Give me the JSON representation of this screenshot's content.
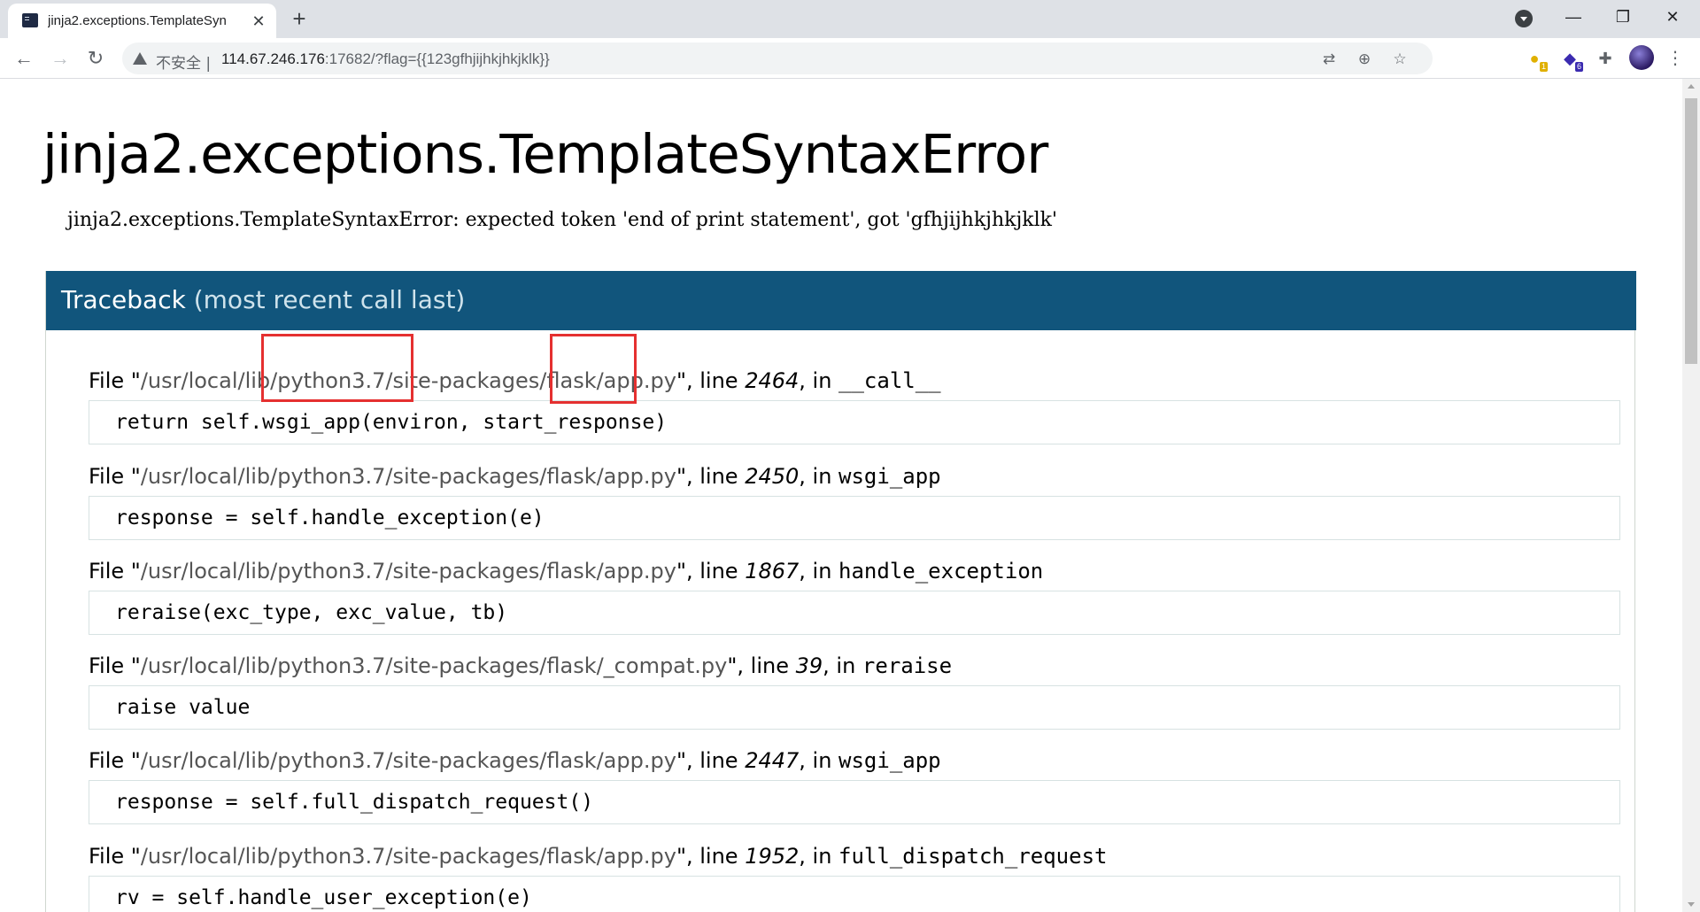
{
  "browser": {
    "tab_title": "jinja2.exceptions.TemplateSyn",
    "tab_close": "✕",
    "new_tab": "+",
    "minimize": "—",
    "maximize": "❐",
    "close": "✕",
    "back": "←",
    "forward": "→",
    "reload": "↻",
    "insecure_label": "不安全 |",
    "url_host": "114.67.246.176",
    "url_rest": ":17682/?flag={{123gfhjijhkjhkjklk}}",
    "translate_icon": "⇄",
    "zoom_icon": "⊕",
    "star_icon": "☆",
    "ext1_badge": "1",
    "ext2_badge": "6",
    "puzzle_icon": "✚",
    "menu": "⋮",
    "icons": [
      "terminal-favicon",
      "tab-search-icon",
      "warning-icon",
      "translate-icon",
      "zoom-icon",
      "bookmark-star-icon",
      "extension-icon",
      "puzzle-icon",
      "avatar"
    ]
  },
  "page": {
    "title": "jinja2.exceptions.TemplateSyntaxError",
    "message": "jinja2.exceptions.TemplateSyntaxError: expected token 'end of print statement', got 'gfhjijhkjhkjklk'",
    "traceback_label": "Traceback",
    "traceback_sub": "(most recent call last)",
    "frames": [
      {
        "file_prefix": "File \"",
        "path": "/usr/local/lib/python3.7/site-packages/flask/app.py",
        "line_label": "\", line ",
        "lineno": "2464",
        "in_label": ", in ",
        "func": "__call__",
        "code": "return self.wsgi_app(environ, start_response)"
      },
      {
        "file_prefix": "File \"",
        "path": "/usr/local/lib/python3.7/site-packages/flask/app.py",
        "line_label": "\", line ",
        "lineno": "2450",
        "in_label": ", in ",
        "func": "wsgi_app",
        "code": "response = self.handle_exception(e)"
      },
      {
        "file_prefix": "File \"",
        "path": "/usr/local/lib/python3.7/site-packages/flask/app.py",
        "line_label": "\", line ",
        "lineno": "1867",
        "in_label": ", in ",
        "func": "handle_exception",
        "code": "reraise(exc_type, exc_value, tb)"
      },
      {
        "file_prefix": "File \"",
        "path": "/usr/local/lib/python3.7/site-packages/flask/_compat.py",
        "line_label": "\", line ",
        "lineno": "39",
        "in_label": ", in ",
        "func": "reraise",
        "code": "raise value"
      },
      {
        "file_prefix": "File \"",
        "path": "/usr/local/lib/python3.7/site-packages/flask/app.py",
        "line_label": "\", line ",
        "lineno": "2447",
        "in_label": ", in ",
        "func": "wsgi_app",
        "code": "response = self.full_dispatch_request()"
      },
      {
        "file_prefix": "File \"",
        "path": "/usr/local/lib/python3.7/site-packages/flask/app.py",
        "line_label": "\", line ",
        "lineno": "1952",
        "in_label": ", in ",
        "func": "full_dispatch_request",
        "code": "rv = self.handle_user_exception(e)"
      }
    ]
  },
  "colors": {
    "traceback_header": "#11557c",
    "annotation": "#e53030",
    "path_text": "#555555"
  }
}
